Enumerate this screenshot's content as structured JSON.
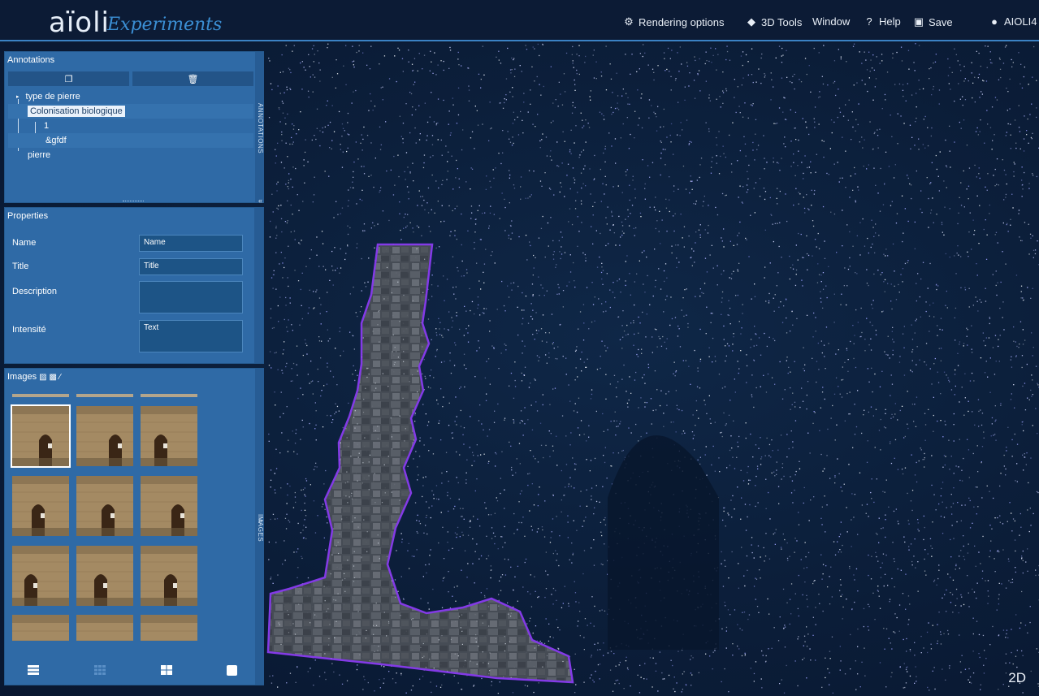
{
  "app": {
    "logo": "aïoli",
    "logo_sub": "Experiments"
  },
  "menu": {
    "rendering": "Rendering options",
    "tools3d": "3D Tools",
    "window": "Window",
    "help": "Help",
    "save": "Save",
    "user": "AIOLI4"
  },
  "annotations": {
    "title": "Annotations",
    "tab_label": "ANNOTATIONS",
    "tree": [
      "type de pierre",
      "Colonisation biologique",
      "1",
      "&gfdf",
      "pierre"
    ]
  },
  "properties": {
    "title": "Properties",
    "fields": [
      {
        "label": "Name",
        "value": "Name"
      },
      {
        "label": "Title",
        "value": "Title"
      },
      {
        "label": "Description",
        "value": ""
      },
      {
        "label": "Intensité",
        "value": "Text"
      }
    ]
  },
  "images": {
    "title": "Images",
    "tab_label": "IMAGES"
  },
  "viewport": {
    "mode": "2D"
  },
  "colors": {
    "accent": "#3b82c4",
    "panel": "#2f6aa6",
    "outline": "#8a3cf0",
    "background": "#0b1a33"
  }
}
